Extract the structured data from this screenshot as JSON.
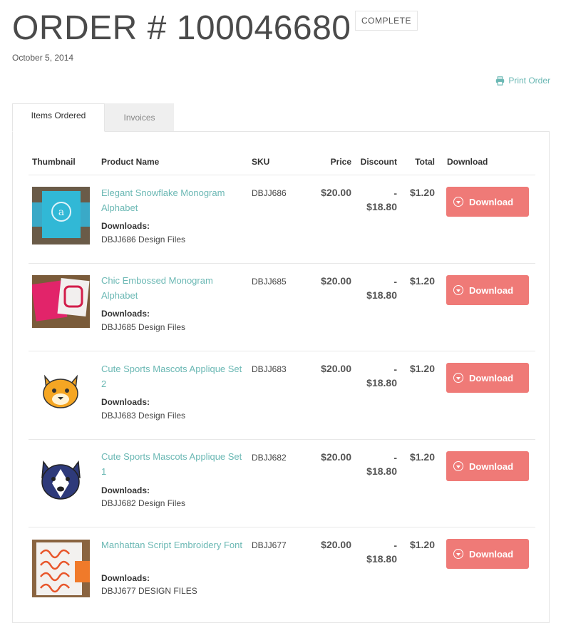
{
  "order": {
    "title": "ORDER # 100046680",
    "status": "COMPLETE",
    "date": "October 5, 2014",
    "print_label": "Print Order"
  },
  "tabs": [
    {
      "label": "Items Ordered",
      "active": true
    },
    {
      "label": "Invoices",
      "active": false
    }
  ],
  "table": {
    "headers": [
      "Thumbnail",
      "Product Name",
      "SKU",
      "Price",
      "Discount",
      "Total",
      "Download"
    ]
  },
  "items": [
    {
      "name": "Elegant Snowflake Monogram Alphabet",
      "downloads_label": "Downloads:",
      "file": "DBJJ686 Design Files",
      "sku": "DBJJ686",
      "price": "$20.00",
      "discount_sign": "-",
      "discount": "$18.80",
      "total": "$1.20",
      "button": "Download",
      "thumb_icon": "snowflake-monogram-thumbnail"
    },
    {
      "name": "Chic Embossed Monogram Alphabet",
      "downloads_label": "Downloads:",
      "file": "DBJJ685 Design Files",
      "sku": "DBJJ685",
      "price": "$20.00",
      "discount_sign": "-",
      "discount": "$18.80",
      "total": "$1.20",
      "button": "Download",
      "thumb_icon": "embossed-monogram-thumbnail"
    },
    {
      "name": "Cute Sports Mascots Applique Set 2",
      "downloads_label": "Downloads:",
      "file": "DBJJ683 Design Files",
      "sku": "DBJJ683",
      "price": "$20.00",
      "discount_sign": "-",
      "discount": "$18.80",
      "total": "$1.20",
      "button": "Download",
      "thumb_icon": "tiger-mascot-thumbnail"
    },
    {
      "name": "Cute Sports Mascots Applique Set 1",
      "downloads_label": "Downloads:",
      "file": "DBJJ682 Design Files",
      "sku": "DBJJ682",
      "price": "$20.00",
      "discount_sign": "-",
      "discount": "$18.80",
      "total": "$1.20",
      "button": "Download",
      "thumb_icon": "husky-mascot-thumbnail"
    },
    {
      "name": "Manhattan Script Embroidery Font",
      "downloads_label": "Downloads:",
      "file": "DBJJ677 DESIGN FILES",
      "sku": "DBJJ677",
      "price": "$20.00",
      "discount_sign": "-",
      "discount": "$18.80",
      "total": "$1.20",
      "button": "Download",
      "thumb_icon": "script-font-thumbnail"
    }
  ],
  "colors": {
    "accent": "#6bb8b4",
    "button": "#ef7a77"
  }
}
